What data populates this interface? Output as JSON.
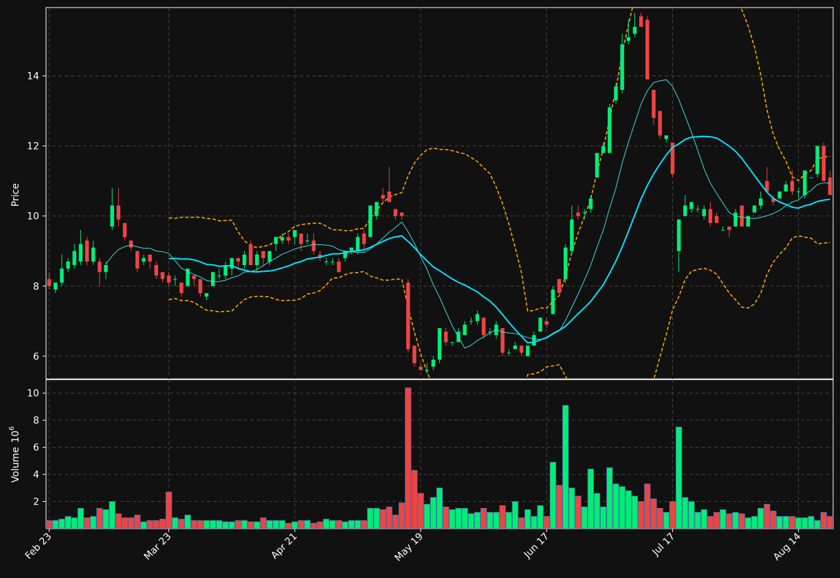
{
  "chart_data": {
    "type": "candlestick",
    "x_tick_labels": [
      "Feb 23",
      "Mar 23",
      "Apr 21",
      "May 19",
      "Jun 17",
      "Jul 17",
      "Aug 14"
    ],
    "x_tick_index": [
      0,
      19,
      39,
      59,
      79,
      99,
      119
    ],
    "price_panel": {
      "ylabel": "Price",
      "ylim": [
        5.35,
        15.95
      ],
      "yticks": [
        6,
        8,
        10,
        12,
        14
      ],
      "grid": true,
      "colors": {
        "up": "#00ee77",
        "down": "#ee4444",
        "ma_fast": "#40e0e0",
        "ma_slow": "#00e5ff",
        "bands": "#ffa500"
      }
    },
    "volume_panel": {
      "ylabel": "Volume",
      "ylabel_exp": "6",
      "ylabel_base": "10",
      "ylim": [
        0,
        11
      ],
      "yticks": [
        2,
        4,
        6,
        8,
        10
      ],
      "grid": true
    },
    "candles": [
      [
        8.2,
        8.4,
        7.9,
        8.0
      ],
      [
        7.9,
        8.1,
        7.8,
        8.1
      ],
      [
        8.1,
        8.9,
        8.0,
        8.5
      ],
      [
        8.5,
        8.8,
        8.4,
        8.7
      ],
      [
        8.6,
        9.2,
        8.5,
        9.0
      ],
      [
        8.7,
        9.6,
        8.6,
        9.2
      ],
      [
        9.3,
        9.4,
        8.6,
        8.7
      ],
      [
        8.7,
        9.3,
        8.6,
        9.1
      ],
      [
        8.7,
        8.8,
        8.0,
        8.4
      ],
      [
        8.4,
        8.7,
        8.2,
        8.6
      ],
      [
        9.7,
        10.8,
        9.6,
        10.3
      ],
      [
        10.3,
        10.8,
        9.7,
        9.9
      ],
      [
        9.8,
        9.8,
        9.3,
        9.4
      ],
      [
        9.3,
        9.3,
        9.0,
        9.1
      ],
      [
        9.0,
        9.0,
        8.4,
        8.5
      ],
      [
        8.7,
        8.9,
        8.6,
        8.8
      ],
      [
        8.9,
        8.9,
        8.5,
        8.7
      ],
      [
        8.6,
        8.7,
        8.2,
        8.3
      ],
      [
        8.4,
        8.4,
        8.1,
        8.2
      ],
      [
        8.3,
        8.4,
        8.0,
        8.1
      ],
      [
        8.2,
        8.3,
        8.0,
        8.2
      ],
      [
        8.1,
        8.1,
        7.7,
        7.8
      ],
      [
        8.0,
        8.5,
        8.0,
        8.5
      ],
      [
        8.3,
        8.3,
        8.0,
        8.2
      ],
      [
        8.2,
        8.2,
        7.7,
        7.8
      ],
      [
        7.7,
        7.8,
        7.6,
        7.8
      ],
      [
        8.0,
        8.4,
        8.0,
        8.4
      ],
      [
        8.3,
        8.5,
        8.2,
        8.3
      ],
      [
        8.3,
        8.7,
        8.2,
        8.6
      ],
      [
        8.5,
        8.7,
        8.3,
        8.8
      ],
      [
        8.8,
        8.8,
        8.5,
        8.7
      ],
      [
        8.6,
        9.0,
        8.5,
        8.9
      ],
      [
        9.2,
        9.3,
        8.6,
        8.6
      ],
      [
        8.6,
        9.0,
        8.4,
        8.9
      ],
      [
        9.0,
        9.0,
        8.6,
        8.8
      ],
      [
        8.7,
        9.0,
        8.6,
        9.0
      ],
      [
        9.2,
        9.4,
        9.0,
        9.4
      ],
      [
        9.3,
        9.5,
        9.2,
        9.4
      ],
      [
        9.4,
        9.5,
        9.2,
        9.3
      ],
      [
        9.4,
        9.6,
        9.2,
        9.6
      ],
      [
        9.5,
        9.5,
        9.0,
        9.2
      ],
      [
        9.3,
        9.5,
        9.2,
        9.3
      ],
      [
        9.3,
        9.5,
        8.9,
        9.0
      ],
      [
        8.9,
        9.0,
        8.7,
        8.8
      ],
      [
        8.7,
        8.8,
        8.6,
        8.7
      ],
      [
        8.7,
        8.8,
        8.6,
        8.7
      ],
      [
        8.7,
        8.8,
        8.4,
        8.4
      ],
      [
        8.8,
        9.0,
        8.7,
        9.0
      ],
      [
        9.0,
        9.1,
        8.9,
        9.1
      ],
      [
        9.0,
        9.5,
        8.9,
        9.4
      ],
      [
        9.5,
        9.6,
        9.0,
        9.2
      ],
      [
        9.4,
        10.3,
        9.4,
        10.3
      ],
      [
        10.0,
        10.4,
        9.9,
        10.4
      ],
      [
        10.6,
        10.8,
        10.4,
        10.5
      ],
      [
        10.7,
        11.4,
        10.5,
        10.4
      ],
      [
        10.2,
        10.2,
        9.9,
        10.0
      ],
      [
        10.1,
        10.1,
        9.9,
        10.0
      ],
      [
        8.1,
        8.2,
        6.1,
        6.2
      ],
      [
        6.3,
        6.3,
        5.7,
        5.8
      ],
      [
        5.7,
        5.8,
        5.6,
        5.6
      ],
      [
        5.6,
        5.8,
        5.5,
        5.6
      ],
      [
        5.7,
        6.0,
        5.6,
        5.9
      ],
      [
        5.9,
        6.8,
        5.8,
        6.8
      ],
      [
        6.7,
        6.8,
        6.3,
        6.4
      ],
      [
        6.4,
        6.4,
        6.3,
        6.4
      ],
      [
        6.4,
        6.8,
        6.4,
        6.7
      ],
      [
        6.6,
        7.0,
        6.6,
        6.9
      ],
      [
        7.0,
        7.1,
        6.9,
        7.0
      ],
      [
        7.0,
        7.3,
        6.9,
        7.2
      ],
      [
        7.1,
        7.1,
        6.5,
        6.6
      ],
      [
        6.7,
        6.8,
        6.6,
        6.7
      ],
      [
        6.6,
        7.0,
        6.5,
        6.9
      ],
      [
        6.8,
        6.8,
        6.0,
        6.1
      ],
      [
        6.1,
        6.2,
        6.0,
        6.1
      ],
      [
        6.2,
        6.4,
        6.2,
        6.3
      ],
      [
        6.3,
        6.3,
        6.0,
        6.1
      ],
      [
        6.0,
        6.3,
        6.0,
        6.3
      ],
      [
        6.3,
        6.7,
        6.3,
        6.6
      ],
      [
        6.7,
        7.1,
        6.7,
        7.1
      ],
      [
        7.0,
        7.1,
        6.8,
        6.9
      ],
      [
        7.2,
        8.0,
        7.2,
        7.9
      ],
      [
        8.2,
        8.2,
        7.7,
        7.8
      ],
      [
        8.2,
        9.2,
        8.1,
        9.1
      ],
      [
        9.0,
        10.3,
        8.9,
        9.9
      ],
      [
        10.1,
        10.3,
        9.9,
        10.0
      ],
      [
        10.1,
        10.2,
        9.9,
        10.1
      ],
      [
        10.2,
        10.6,
        10.1,
        10.5
      ],
      [
        11.1,
        11.8,
        11.1,
        11.8
      ],
      [
        11.8,
        12.1,
        11.8,
        12.0
      ],
      [
        11.8,
        13.2,
        11.8,
        13.1
      ],
      [
        13.3,
        13.8,
        13.2,
        13.7
      ],
      [
        13.6,
        15.2,
        13.5,
        14.9
      ],
      [
        15.0,
        15.6,
        14.9,
        15.1
      ],
      [
        15.2,
        15.8,
        15.1,
        15.4
      ],
      [
        15.7,
        15.8,
        15.4,
        15.4
      ],
      [
        15.6,
        15.7,
        13.9,
        13.9
      ],
      [
        13.6,
        13.6,
        12.6,
        12.8
      ],
      [
        13.0,
        13.0,
        12.2,
        12.3
      ],
      [
        12.2,
        12.3,
        12.1,
        12.3
      ],
      [
        12.1,
        12.1,
        11.1,
        11.2
      ],
      [
        9.0,
        9.7,
        8.4,
        9.9
      ],
      [
        10.0,
        10.6,
        10.0,
        10.3
      ],
      [
        10.2,
        10.4,
        10.1,
        10.4
      ],
      [
        10.2,
        10.3,
        10.1,
        10.2
      ],
      [
        10.0,
        10.3,
        9.9,
        10.2
      ],
      [
        10.2,
        10.4,
        9.7,
        9.8
      ],
      [
        10.0,
        10.1,
        9.8,
        9.8
      ],
      [
        9.6,
        9.7,
        9.6,
        9.6
      ],
      [
        9.7,
        9.7,
        9.4,
        9.6
      ],
      [
        9.7,
        10.2,
        9.7,
        10.1
      ],
      [
        10.3,
        10.3,
        9.7,
        9.7
      ],
      [
        9.7,
        10.0,
        9.7,
        10.0
      ],
      [
        10.1,
        10.3,
        10.1,
        10.3
      ],
      [
        10.3,
        10.7,
        10.2,
        10.5
      ],
      [
        11.0,
        11.4,
        10.7,
        10.7
      ],
      [
        10.5,
        10.6,
        10.3,
        10.4
      ],
      [
        10.5,
        10.7,
        10.5,
        10.7
      ],
      [
        10.7,
        11.0,
        10.7,
        10.9
      ],
      [
        11.0,
        11.3,
        10.6,
        10.7
      ],
      [
        10.7,
        10.8,
        10.5,
        10.7
      ],
      [
        10.6,
        11.3,
        10.5,
        11.3
      ],
      [
        11.1,
        11.1,
        11.1,
        11.1
      ],
      [
        11.2,
        12.0,
        11.1,
        12.0
      ],
      [
        12.0,
        12.1,
        11.1,
        11.0
      ],
      [
        11.1,
        11.3,
        10.6,
        10.6
      ]
    ],
    "volume": [
      0.6,
      0.6,
      0.7,
      0.9,
      0.8,
      1.5,
      0.8,
      0.9,
      1.5,
      1.4,
      2.0,
      1.1,
      0.8,
      0.8,
      1.0,
      0.5,
      0.6,
      0.6,
      0.7,
      2.7,
      0.8,
      0.7,
      1.0,
      0.6,
      0.6,
      0.6,
      0.6,
      0.6,
      0.5,
      0.5,
      0.6,
      0.6,
      0.5,
      0.5,
      0.8,
      0.6,
      0.6,
      0.6,
      0.4,
      0.5,
      0.6,
      0.6,
      0.4,
      0.5,
      0.7,
      0.6,
      0.6,
      0.5,
      0.6,
      0.6,
      0.6,
      1.5,
      1.5,
      1.4,
      1.6,
      1.0,
      1.9,
      10.4,
      4.3,
      2.6,
      1.8,
      2.3,
      3.0,
      1.6,
      1.4,
      1.5,
      1.5,
      1.1,
      1.2,
      1.5,
      1.2,
      1.2,
      1.7,
      1.2,
      2.0,
      0.8,
      1.4,
      0.9,
      1.7,
      0.9,
      4.9,
      3.2,
      9.1,
      3.0,
      2.4,
      1.6,
      4.4,
      2.6,
      1.6,
      4.5,
      3.3,
      3.1,
      2.8,
      2.4,
      2.0,
      3.3,
      2.2,
      1.5,
      1.2,
      2.0,
      7.5,
      2.3,
      2.0,
      1.2,
      1.4,
      0.9,
      1.2,
      1.4,
      1.1,
      1.2,
      1.1,
      0.8,
      0.9,
      1.5,
      1.8,
      1.3,
      0.9,
      0.9,
      0.9,
      0.8,
      0.8,
      0.9,
      0.6,
      1.2,
      0.9,
      1.0
    ]
  }
}
